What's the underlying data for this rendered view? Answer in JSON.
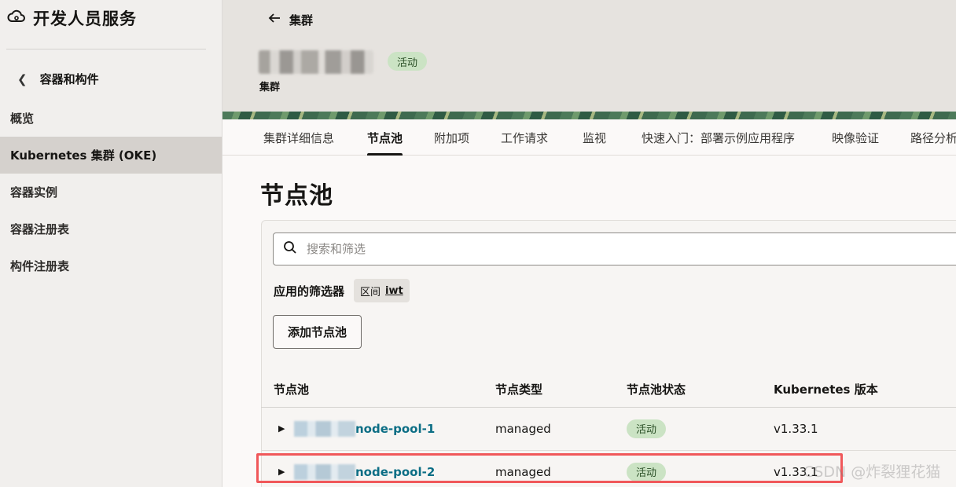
{
  "sidebar": {
    "title": "开发人员服务",
    "back_label": "容器和构件",
    "items": [
      {
        "label": "概览",
        "active": false
      },
      {
        "label": "Kubernetes 集群 (OKE)",
        "active": true
      },
      {
        "label": "容器实例",
        "active": false
      },
      {
        "label": "容器注册表",
        "active": false
      },
      {
        "label": "构件注册表",
        "active": false
      }
    ]
  },
  "header": {
    "back_label": "集群",
    "status": "活动",
    "subtitle": "集群"
  },
  "tabs": [
    {
      "label": "集群详细信息",
      "active": false
    },
    {
      "label": "节点池",
      "active": true
    },
    {
      "label": "附加项",
      "active": false
    },
    {
      "label": "工作请求",
      "active": false
    },
    {
      "label": "监视",
      "active": false
    },
    {
      "label": "快速入门：部署示例应用程序",
      "active": false
    },
    {
      "label": "映像验证",
      "active": false
    },
    {
      "label": "路径分析",
      "active": false
    }
  ],
  "main": {
    "title": "节点池",
    "search_placeholder": "搜索和筛选",
    "applied_filters_label": "应用的筛选器",
    "filter_chip": {
      "key": "区间",
      "value": "iwt"
    },
    "add_button": "添加节点池"
  },
  "table": {
    "columns": [
      "节点池",
      "节点类型",
      "节点池状态",
      "Kubernetes 版本"
    ],
    "rows": [
      {
        "name": "node-pool-1",
        "type": "managed",
        "status": "活动",
        "version": "v1.33.1"
      },
      {
        "name": "node-pool-2",
        "type": "managed",
        "status": "活动",
        "version": "v1.33.1"
      }
    ]
  },
  "watermark": "CSDN @炸裂狸花猫",
  "colors": {
    "accent_link": "#0c6e85",
    "status_bg": "#cbe3c4",
    "highlight": "#f0585a"
  }
}
